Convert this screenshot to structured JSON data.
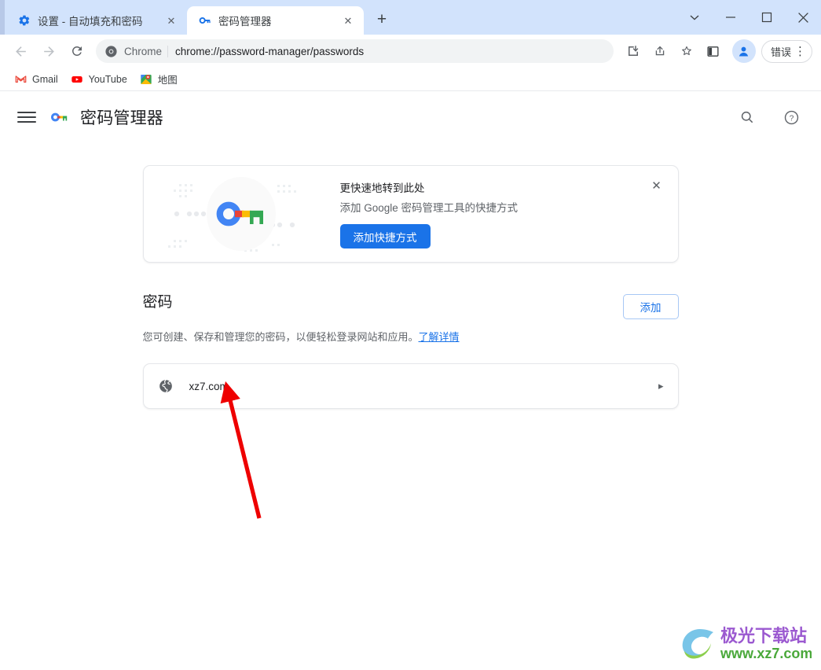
{
  "window": {
    "controls": [
      {
        "name": "tab-search",
        "glyph": "⌄"
      },
      {
        "name": "minimize",
        "glyph": "─"
      },
      {
        "name": "maximize",
        "glyph": "□"
      },
      {
        "name": "close",
        "glyph": "✕"
      }
    ]
  },
  "tabs": [
    {
      "title": "设置 - 自动填充和密码",
      "favicon": "settings-gear-icon",
      "active": false,
      "close": "✕"
    },
    {
      "title": "密码管理器",
      "favicon": "key-icon",
      "active": true,
      "close": "✕"
    }
  ],
  "newtab_label": "+",
  "toolbar": {
    "back": "←",
    "forward": "→",
    "reload": "↻",
    "omnibox": {
      "scheme_label": "Chrome",
      "url": "chrome://password-manager/passwords",
      "icon": "chrome-logo-icon"
    },
    "icons": [
      {
        "name": "downloads-icon"
      },
      {
        "name": "share-icon"
      },
      {
        "name": "bookmark-star-icon"
      },
      {
        "name": "side-panel-icon"
      }
    ],
    "profile_icon": "profile-avatar-icon",
    "error_chip_label": "错误",
    "menu_glyph": "⋮"
  },
  "bookmarks": [
    {
      "label": "Gmail",
      "icon": "gmail-icon"
    },
    {
      "label": "YouTube",
      "icon": "youtube-icon"
    },
    {
      "label": "地图",
      "icon": "maps-icon"
    }
  ],
  "pm_header": {
    "menu_icon": "hamburger-menu-icon",
    "logo_icon": "google-password-key-icon",
    "title": "密码管理器",
    "search_icon": "search-icon",
    "help_icon": "help-circle-icon"
  },
  "promo": {
    "heading": "更快速地转到此处",
    "subtext": "添加 Google 密码管理工具的快捷方式",
    "button_label": "添加快捷方式",
    "close_glyph": "✕"
  },
  "passwords_section": {
    "title": "密码",
    "add_button_label": "添加",
    "description_text": "您可创建、保存和管理您的密码，以便轻松登录网站和应用。",
    "description_link": "了解详情",
    "entries": [
      {
        "site": "xz7.com",
        "icon": "globe-icon",
        "chevron": "▸"
      }
    ]
  },
  "watermark": {
    "title": "极光下载站",
    "url": "www.xz7.com"
  },
  "colors": {
    "accent_blue": "#1a73e8",
    "tabstrip_blue": "#d2e3fc",
    "text_primary": "#202124",
    "text_secondary": "#5f6368",
    "annotation_red": "#ee0000"
  }
}
